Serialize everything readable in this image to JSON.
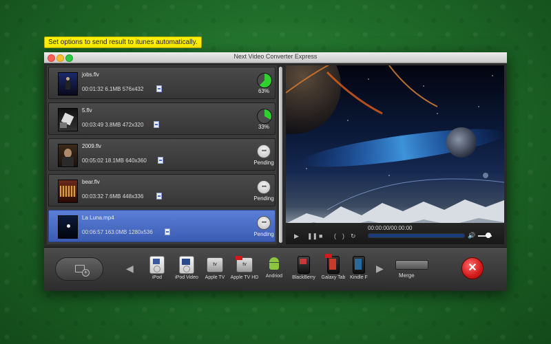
{
  "tooltip": "Set options to send result to itunes automatically.",
  "window": {
    "title": "Next Video Converter Express"
  },
  "files": [
    {
      "name": "jobs.flv",
      "duration": "00:01:32",
      "size": "6.1MB",
      "resolution": "576x432",
      "status": "63%",
      "progress": 0.63
    },
    {
      "name": "5.flv",
      "duration": "00:03:49",
      "size": "3.8MB",
      "resolution": "472x320",
      "status": "33%",
      "progress": 0.33
    },
    {
      "name": "2009.flv",
      "duration": "00:05:02",
      "size": "18.1MB",
      "resolution": "640x360",
      "status": "Pending",
      "progress": null
    },
    {
      "name": "bear.flv",
      "duration": "00:03:32",
      "size": "7.6MB",
      "resolution": "448x336",
      "status": "Pending",
      "progress": null
    },
    {
      "name": "La Luna.mp4",
      "duration": "00:06:57",
      "size": "163.0MB",
      "resolution": "1280x536",
      "status": "Pending",
      "progress": null,
      "selected": true
    }
  ],
  "player": {
    "timecode": "00:00:00/00:00:00"
  },
  "devices": [
    {
      "label": "iPod",
      "icon": "ipod-icon"
    },
    {
      "label": "iPod Video",
      "icon": "ipod-video-icon"
    },
    {
      "label": "Apple TV",
      "icon": "apple-tv-icon"
    },
    {
      "label": "Apple TV HD",
      "icon": "apple-tv-hd-icon"
    },
    {
      "label": "Andriod",
      "icon": "android-icon"
    },
    {
      "label": "BlackBerry",
      "icon": "blackberry-icon"
    },
    {
      "label": "Galaxy Tab",
      "icon": "galaxy-tab-icon"
    },
    {
      "label": "Kindle F",
      "icon": "kindle-fire-icon"
    }
  ],
  "merge": {
    "label": "Merge",
    "on": false
  },
  "colors": {
    "progress_green": "#2fcf2f",
    "selected_row": "#4a6fcf",
    "cancel_red": "#d21a1a",
    "tooltip_yellow": "#fff200"
  }
}
